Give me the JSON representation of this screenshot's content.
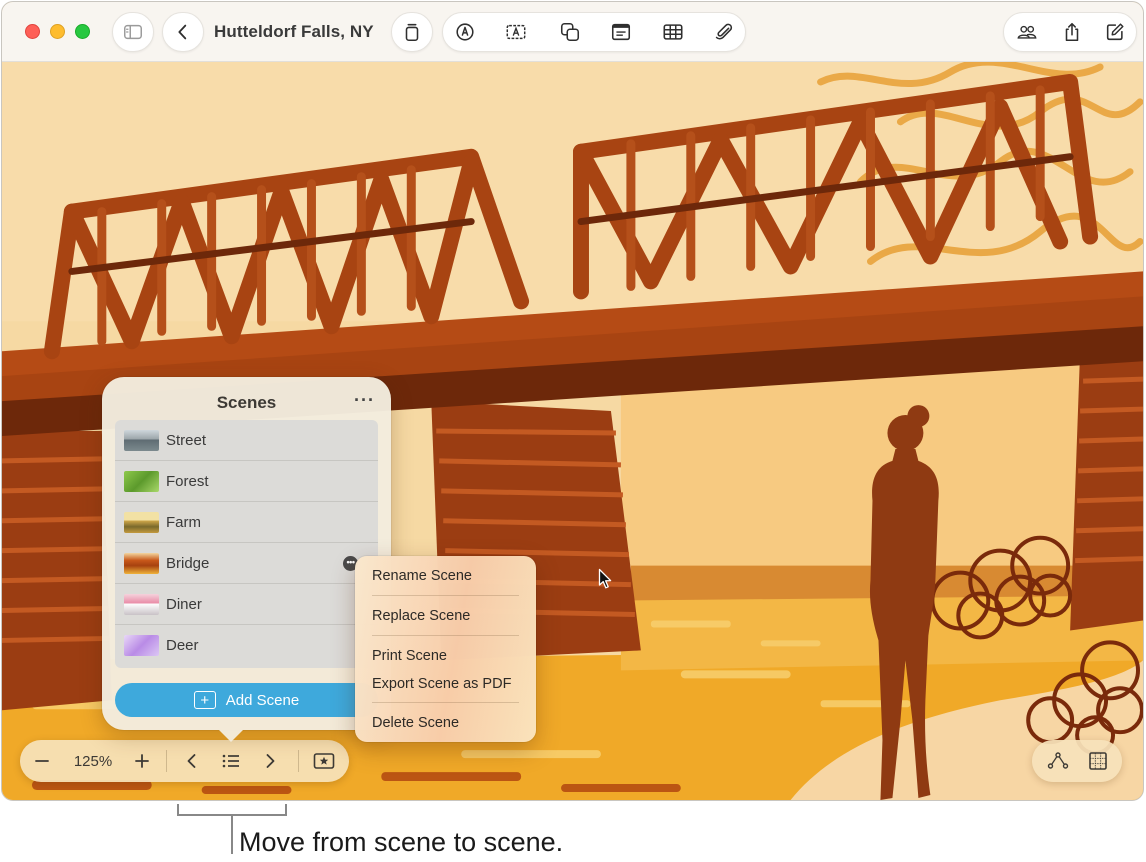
{
  "window": {
    "title": "Hutteldorf Falls, NY"
  },
  "toolbar": {
    "left_icons": [
      "sidebar-icon",
      "back-chevron-icon"
    ],
    "center_icons": [
      "pages-icon",
      "pen-icon",
      "text-box-icon",
      "shapes-icon",
      "media-icon",
      "table-icon",
      "attachment-icon"
    ],
    "right_icons": [
      "collaborate-icon",
      "share-icon",
      "compose-icon"
    ]
  },
  "scenes_panel": {
    "title": "Scenes",
    "more": "···",
    "items": [
      {
        "label": "Street"
      },
      {
        "label": "Forest"
      },
      {
        "label": "Farm"
      },
      {
        "label": "Bridge"
      },
      {
        "label": "Diner"
      },
      {
        "label": "Deer"
      }
    ],
    "add_button": "Add Scene"
  },
  "context_menu": {
    "items": [
      "Rename Scene",
      "Replace Scene",
      "Print Scene",
      "Export Scene as PDF",
      "Delete Scene"
    ]
  },
  "navbar": {
    "zoom": "125%",
    "minus": "−",
    "plus": "+"
  },
  "caption": "Move from scene to scene.",
  "colors": {
    "accent": "#3ea9dc",
    "bridge": "#a33f10",
    "bridge_dark": "#6f2a0c",
    "sky": "#f6d9a3",
    "ground": "#f0a928"
  }
}
